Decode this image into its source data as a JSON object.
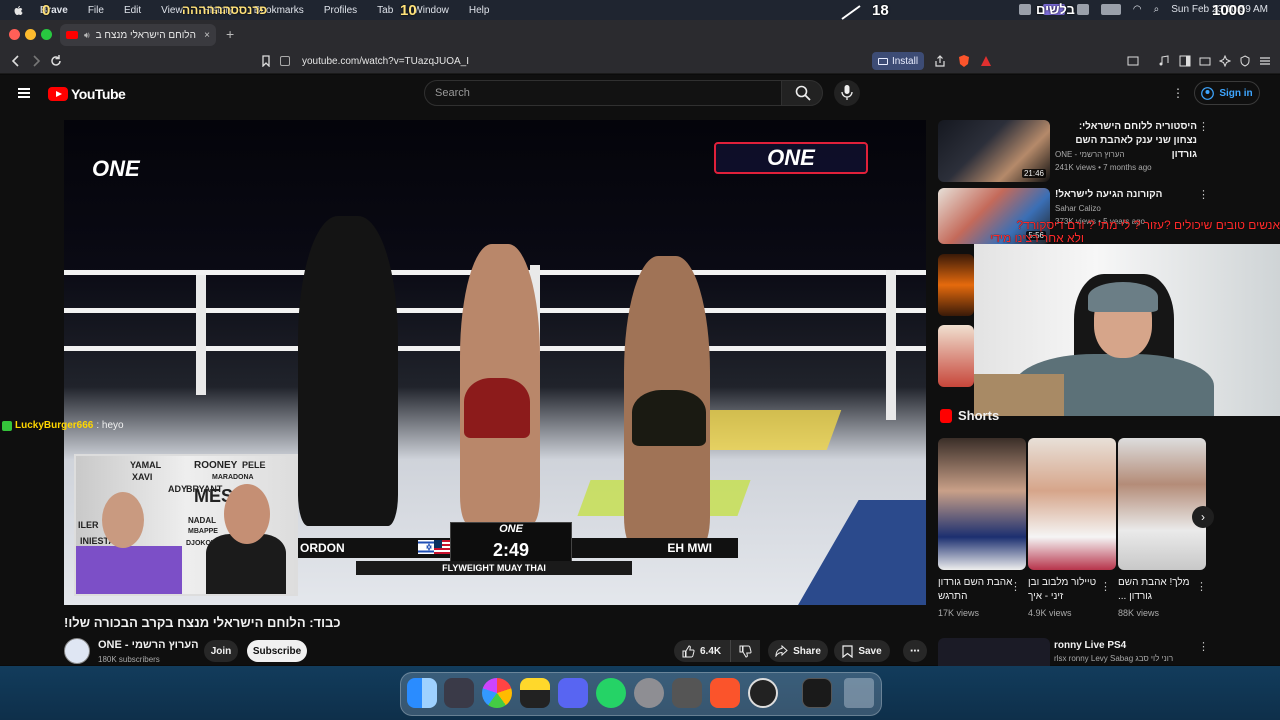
{
  "menubar": {
    "app": "Brave",
    "items": [
      "File",
      "Edit",
      "View",
      "History",
      "Bookmarks",
      "Profiles",
      "Tab",
      "Window",
      "Help"
    ],
    "datetime": "Sun Feb 23  10:59 AM",
    "overlay": {
      "n0": "0",
      "n10": "10",
      "n18": "18",
      "n1000": "1000",
      "hebrew_left": "פרנססהההההה",
      "hebrew_right": "בלשים"
    }
  },
  "browser": {
    "tab_title": "כבוד: הלוחם הישראלי מנצח ב",
    "url": "youtube.com/watch?v=TUazqJUOA_I",
    "install_label": "Install",
    "new_tab": "+",
    "close_tab": "×"
  },
  "youtube": {
    "logo_text": "YouTube",
    "search_placeholder": "Search",
    "signin_label": "Sign in"
  },
  "video": {
    "brand_left": "ONE",
    "brand_right": "ONE",
    "scoreboard": {
      "left_name": "ORDON",
      "right_name": "EH MWI",
      "brand": "ONE",
      "time": "2:49",
      "event": "FLYWEIGHT MUAY THAI"
    },
    "chat": {
      "user": "LuckyBurger666",
      "text": ": heyo"
    },
    "wall_words": [
      "YAMAL",
      "XAVI",
      "ROONEY",
      "PELE",
      "BRYANT",
      "MARADONA",
      "MESSI",
      "NADAL",
      "MBAPPE",
      "DJOKOVIC",
      "INIESTA",
      "ADY",
      "ILER"
    ]
  },
  "owner": {
    "title": "כבוד: הלוחם הישראלי מנצח בקרב הבכורה שלו!",
    "channel": "ONE - הערוץ הרשמי",
    "subs": "180K subscribers",
    "join": "Join",
    "subscribe": "Subscribe",
    "likes": "6.4K",
    "share": "Share",
    "save": "Save"
  },
  "sidebar": {
    "recs": [
      {
        "title": "היסטוריה ללוחם הישראלי: נצחון שני ענק לאהבת השם גורדון",
        "channel": "ONE - הערוץ הרשמי",
        "meta": "241K views • 7 months ago",
        "duration": "21:46"
      },
      {
        "title": "הקורונה הגיעה לישראל!",
        "channel": "Sahar Calizo",
        "meta": "373K views • 5 years ago",
        "duration": "5:56"
      }
    ],
    "red_overlay": [
      "אנשים טובים שיכולים ?עזור ? לי מתי ? ורם דיסקורד?",
      "ולא אחר רצינו מידי"
    ],
    "shorts_label": "Shorts",
    "shorts": [
      {
        "title": "אהבת השם גורדון התרגש",
        "views": "17K views"
      },
      {
        "title": "טיילור מלבוב ובן זיני - איך",
        "views": "4.9K views"
      },
      {
        "title": "מלך! אהבת השם גורדון ...",
        "views": "88K views"
      }
    ],
    "bottom": {
      "title": "ronny Live PS4",
      "channel": "rlsx ronny Levy Sabag רוני לוי סבג"
    }
  },
  "colors": {
    "yt_red": "#ff0000",
    "bg": "#0f0f0f",
    "accent_tab": "#3d4c75"
  }
}
